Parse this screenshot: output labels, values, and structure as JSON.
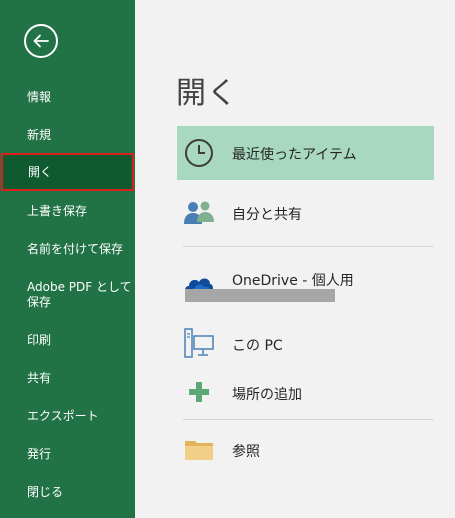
{
  "sidebar": {
    "back_icon": "back-arrow-icon",
    "items": [
      {
        "label": "情報"
      },
      {
        "label": "新規"
      },
      {
        "label": "開く"
      },
      {
        "label": "上書き保存"
      },
      {
        "label": "名前を付けて保存"
      },
      {
        "label": "Adobe PDF として"
      },
      {
        "label": "保存"
      },
      {
        "label": "印刷"
      },
      {
        "label": "共有"
      },
      {
        "label": "エクスポート"
      },
      {
        "label": "発行"
      },
      {
        "label": "閉じる"
      }
    ],
    "selected": "開く"
  },
  "main": {
    "title": "開く",
    "locations": [
      {
        "label": "最近使ったアイテム",
        "icon": "clock-icon"
      },
      {
        "label": "自分と共有",
        "icon": "people-icon"
      },
      {
        "label": "OneDrive - 個人用",
        "icon": "onedrive-cloud-icon"
      },
      {
        "label": "この PC",
        "icon": "computer-icon"
      },
      {
        "label": "場所の追加",
        "icon": "plus-icon"
      },
      {
        "label": "参照",
        "icon": "folder-icon"
      }
    ]
  },
  "colors": {
    "sidebar_bg": "#217346",
    "sidebar_selected_bg": "#0f5a2f",
    "selection_border": "#d9201f",
    "main_bg": "#f2f2f2",
    "recent_highlight": "#a8d8bf"
  }
}
